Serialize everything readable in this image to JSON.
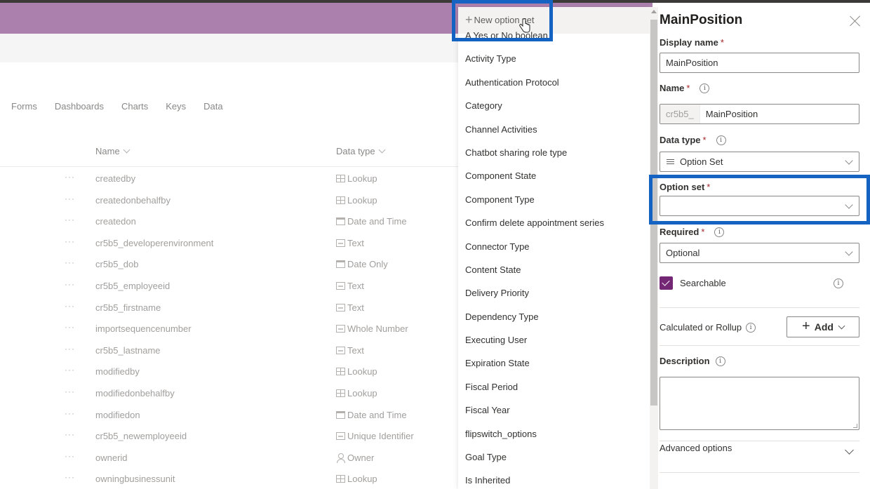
{
  "background": {
    "tabs": [
      "Forms",
      "Dashboards",
      "Charts",
      "Keys",
      "Data"
    ],
    "columns": {
      "name": "Name",
      "data_type": "Data type"
    },
    "rows": [
      {
        "name": "createdby",
        "type": "Lookup",
        "icon": "lookup-icon"
      },
      {
        "name": "createdonbehalfby",
        "type": "Lookup",
        "icon": "lookup-icon"
      },
      {
        "name": "createdon",
        "type": "Date and Time",
        "icon": "date-time-icon"
      },
      {
        "name": "cr5b5_developerenvironment",
        "type": "Text",
        "icon": "text-icon"
      },
      {
        "name": "cr5b5_dob",
        "type": "Date Only",
        "icon": "date-only-icon"
      },
      {
        "name": "cr5b5_employeeid",
        "type": "Text",
        "icon": "text-icon"
      },
      {
        "name": "cr5b5_firstname",
        "type": "Text",
        "icon": "text-icon"
      },
      {
        "name": "importsequencenumber",
        "type": "Whole Number",
        "icon": "whole-number-icon"
      },
      {
        "name": "cr5b5_lastname",
        "type": "Text",
        "icon": "text-icon"
      },
      {
        "name": "modifiedby",
        "type": "Lookup",
        "icon": "lookup-icon"
      },
      {
        "name": "modifiedonbehalfby",
        "type": "Lookup",
        "icon": "lookup-icon"
      },
      {
        "name": "modifiedon",
        "type": "Date and Time",
        "icon": "date-time-icon"
      },
      {
        "name": "cr5b5_newemployeeid",
        "type": "Unique Identifier",
        "icon": "unique-identifier-icon"
      },
      {
        "name": "ownerid",
        "type": "Owner",
        "icon": "owner-icon"
      },
      {
        "name": "owningbusinessunit",
        "type": "Lookup",
        "icon": "lookup-icon"
      }
    ],
    "more_glyph": "···"
  },
  "dropdown": {
    "new_option_set": "New option set",
    "plus_glyph": "+",
    "items": [
      "A Yes or No boolean",
      "Activity Type",
      "Authentication Protocol",
      "Category",
      "Channel Activities",
      "Chatbot sharing role type",
      "Component State",
      "Component Type",
      "Confirm delete appointment series",
      "Connector Type",
      "Content State",
      "Delivery Priority",
      "Dependency Type",
      "Executing User",
      "Expiration State",
      "Fiscal Period",
      "Fiscal Year",
      "flipswitch_options",
      "Goal Type",
      "Is Inherited"
    ]
  },
  "panel": {
    "title": "MainPosition",
    "display_name": {
      "label": "Display name",
      "required": "*",
      "value": "MainPosition"
    },
    "name": {
      "label": "Name",
      "required": "*",
      "prefix": "cr5b5_",
      "value": "MainPosition"
    },
    "data_type": {
      "label": "Data type",
      "required": "*",
      "value": "Option Set"
    },
    "option_set": {
      "label": "Option set",
      "required": "*",
      "value": ""
    },
    "required": {
      "label": "Required",
      "required": "*",
      "value": "Optional"
    },
    "searchable": {
      "label": "Searchable",
      "checked": true
    },
    "calculated": {
      "label": "Calculated or Rollup",
      "add_label": "Add"
    },
    "description": {
      "label": "Description",
      "value": ""
    },
    "advanced": {
      "label": "Advanced options"
    },
    "info_glyph": "i"
  },
  "colors": {
    "header": "#ac80ad",
    "highlight": "#1463c3",
    "checkbox": "#742774"
  }
}
